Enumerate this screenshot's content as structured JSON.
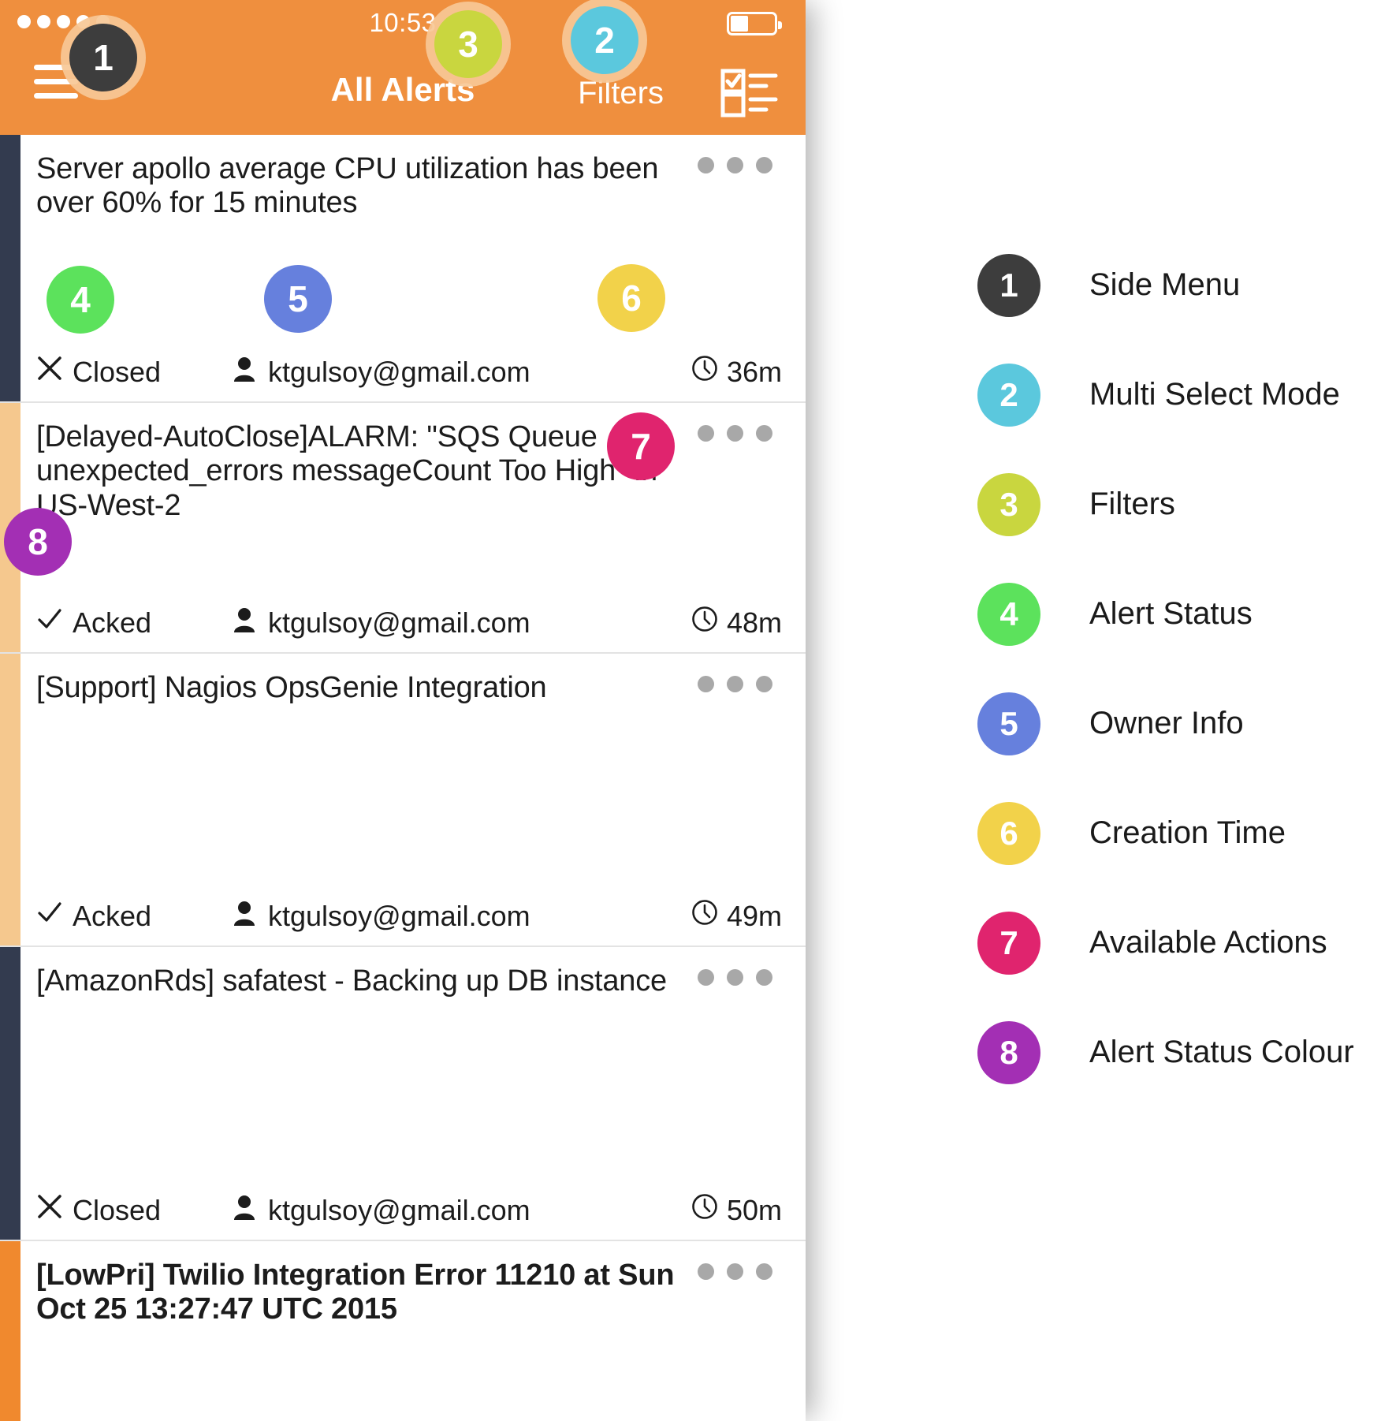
{
  "phone": {
    "status_bar": {
      "signal_dots": 5,
      "time": "10:53",
      "battery_level_pct": 40
    },
    "navbar": {
      "menu_icon": "hamburger-icon",
      "title": "All Alerts",
      "filters_label": "Filters",
      "multiselect_icon": "checklist-icon",
      "background_color": "#ef8f3e"
    },
    "alerts": [
      {
        "message": "Server apollo average CPU utilization has been over 60% for 15 minutes",
        "status": "Closed",
        "status_icon": "x-icon",
        "owner": "ktgulsoy@gmail.com",
        "owner_icon": "person-icon",
        "time": "36m",
        "time_icon": "clock-icon",
        "actions_icon": "kebab-icon",
        "status_color": "#333b4f",
        "bold": false
      },
      {
        "message": "[Delayed-AutoClose]ALARM: \"SQS Queue unexpected_errors messageCount Too High\" in US-West-2",
        "status": "Acked",
        "status_icon": "check-icon",
        "owner": "ktgulsoy@gmail.com",
        "owner_icon": "person-icon",
        "time": "48m",
        "time_icon": "clock-icon",
        "actions_icon": "kebab-icon",
        "status_color": "#f5c88e",
        "bold": false
      },
      {
        "message": "[Support] Nagios OpsGenie Integration",
        "status": "Acked",
        "status_icon": "check-icon",
        "owner": "ktgulsoy@gmail.com",
        "owner_icon": "person-icon",
        "time": "49m",
        "time_icon": "clock-icon",
        "actions_icon": "kebab-icon",
        "status_color": "#f5c88e",
        "bold": false
      },
      {
        "message": "[AmazonRds] safatest - Backing up DB instance",
        "status": "Closed",
        "status_icon": "x-icon",
        "owner": "ktgulsoy@gmail.com",
        "owner_icon": "person-icon",
        "time": "50m",
        "time_icon": "clock-icon",
        "actions_icon": "kebab-icon",
        "status_color": "#333b4f",
        "bold": false
      },
      {
        "message": "[LowPri] Twilio Integration Error 11210 at Sun Oct 25 13:27:47 UTC 2015",
        "status": "",
        "status_icon": "",
        "owner": "",
        "owner_icon": "",
        "time": "",
        "time_icon": "",
        "actions_icon": "kebab-icon",
        "status_color": "#f0892e",
        "bold": true
      }
    ]
  },
  "callouts": [
    {
      "number": "1",
      "color": "#3d3d3d"
    },
    {
      "number": "2",
      "color": "#5bc8dd"
    },
    {
      "number": "3",
      "color": "#c9d63f"
    },
    {
      "number": "4",
      "color": "#5ce25c"
    },
    {
      "number": "5",
      "color": "#6680dd"
    },
    {
      "number": "6",
      "color": "#f2d24a"
    },
    {
      "number": "7",
      "color": "#e0246e"
    },
    {
      "number": "8",
      "color": "#a32fb4"
    }
  ],
  "legend": {
    "items": [
      {
        "number": "1",
        "label": "Side Menu",
        "color": "#3d3d3d"
      },
      {
        "number": "2",
        "label": "Multi Select Mode",
        "color": "#5bc8dd"
      },
      {
        "number": "3",
        "label": "Filters",
        "color": "#c9d63f"
      },
      {
        "number": "4",
        "label": "Alert Status",
        "color": "#5ce25c"
      },
      {
        "number": "5",
        "label": "Owner Info",
        "color": "#6680dd"
      },
      {
        "number": "6",
        "label": "Creation Time",
        "color": "#f2d24a"
      },
      {
        "number": "7",
        "label": "Available Actions",
        "color": "#e0246e"
      },
      {
        "number": "8",
        "label": "Alert Status Colour",
        "color": "#a32fb4"
      }
    ]
  }
}
